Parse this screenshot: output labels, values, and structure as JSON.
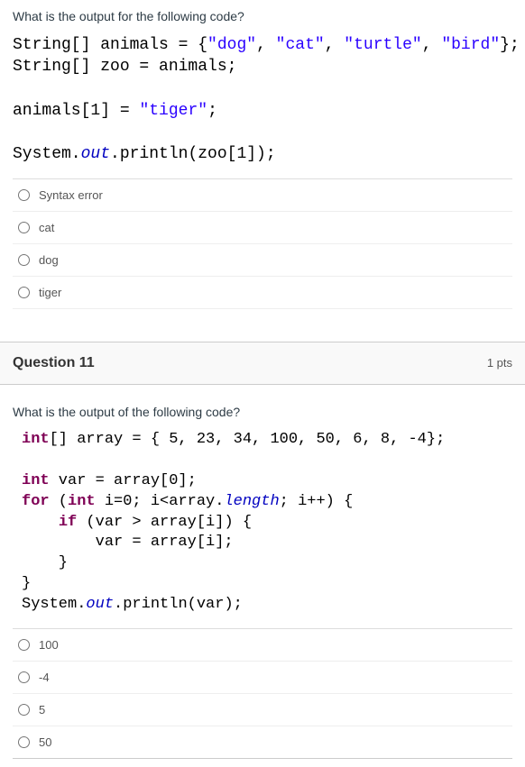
{
  "q10": {
    "prompt": "What is the output for the following code?",
    "code": {
      "l1a": "String[] animals = {",
      "l1s1": "\"dog\"",
      "l1c1": ", ",
      "l1s2": "\"cat\"",
      "l1c2": ", ",
      "l1s3": "\"turtle\"",
      "l1c3": ", ",
      "l1s4": "\"bird\"",
      "l1e": "};",
      "l2": "String[] zoo = animals;",
      "l3a": "animals[1] = ",
      "l3s": "\"tiger\"",
      "l3e": ";",
      "l4a": "System.",
      "l4f": "out",
      "l4b": ".println(zoo[1]);"
    },
    "options": [
      "Syntax error",
      "cat",
      "dog",
      "tiger"
    ]
  },
  "q11": {
    "header": "Question 11",
    "pts": "1 pts",
    "prompt": "What is the output of the following code?",
    "code": {
      "l1a": "int",
      "l1b": "[] array = { 5, 23, 34, 100, 50, 6, 8, -4};",
      "l2a": "int",
      "l2b": " var = array[0];",
      "l3a": "for",
      "l3b": " (",
      "l3c": "int",
      "l3d": " i=0; i<array.",
      "l3len": "length",
      "l3e": "; i++) {",
      "l4a": "    ",
      "l4if": "if",
      "l4b": " (var > array[i]) {",
      "l5": "        var = array[i];",
      "l6": "    }",
      "l7": "}",
      "l8a": "System.",
      "l8f": "out",
      "l8b": ".println(var);"
    },
    "options": [
      "100",
      "-4",
      "5",
      "50"
    ]
  }
}
